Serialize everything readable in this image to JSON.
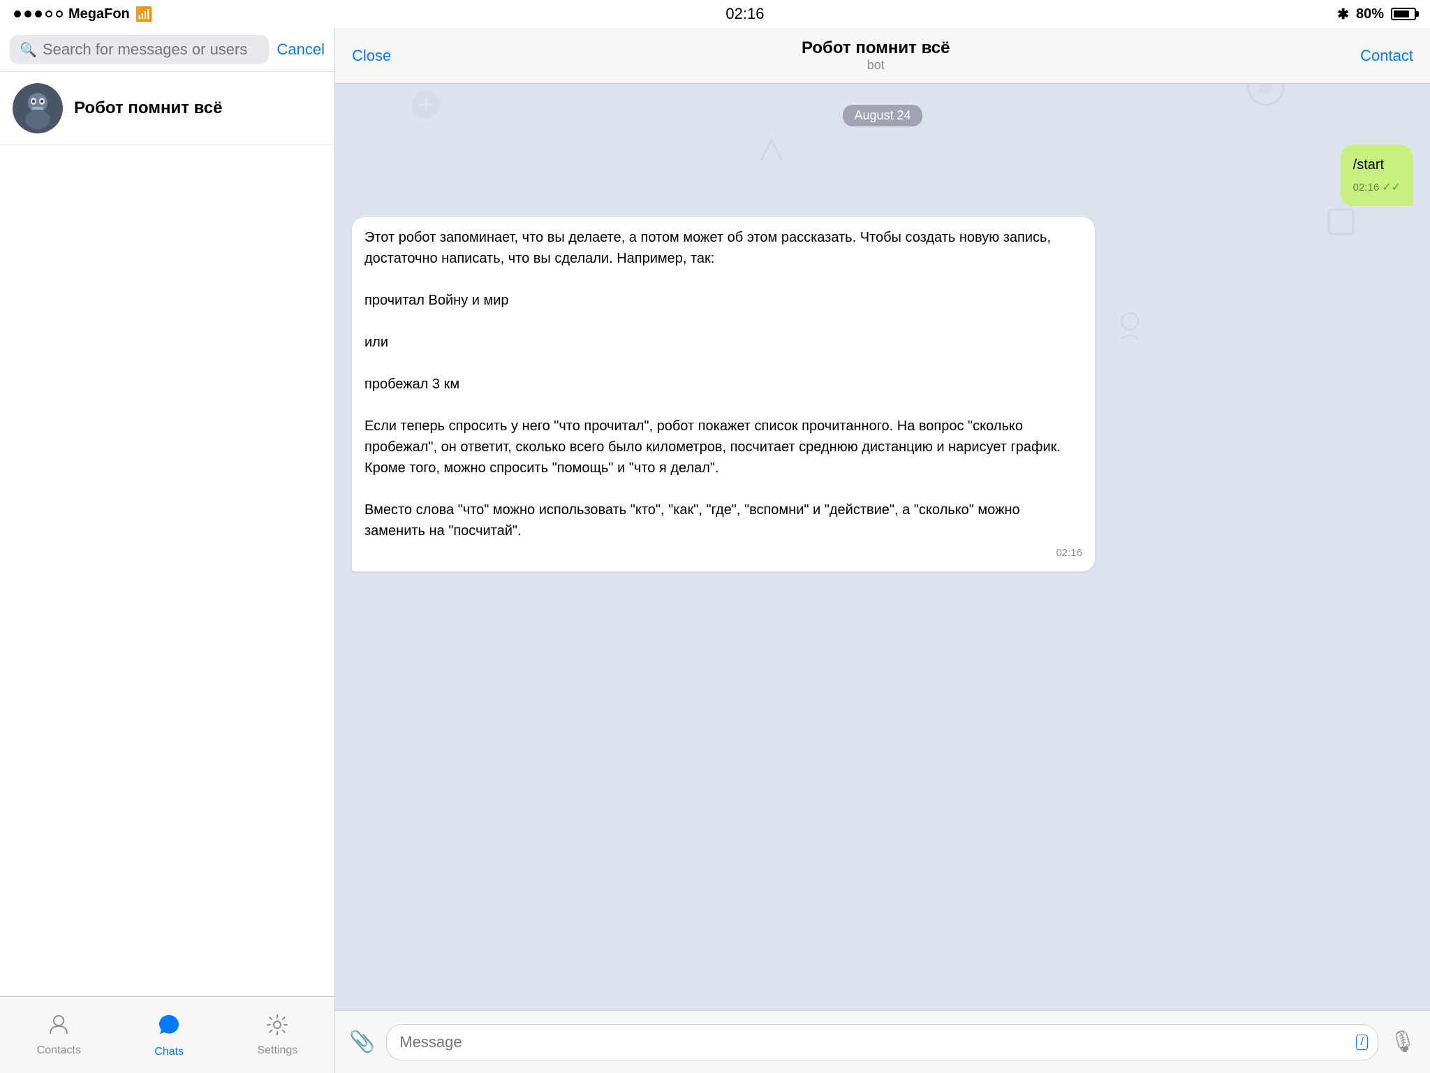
{
  "status_bar": {
    "carrier": "MegaFon",
    "time": "02:16",
    "battery_percent": "80%",
    "bluetooth": "⁎"
  },
  "search": {
    "placeholder": "Search for messages or users",
    "cancel_label": "Cancel"
  },
  "chat_list": {
    "items": [
      {
        "name": "Робот помнит всё",
        "id": "robot-chat"
      }
    ]
  },
  "bottom_nav": {
    "items": [
      {
        "label": "Contacts",
        "icon": "person",
        "active": false
      },
      {
        "label": "Chats",
        "icon": "chat",
        "active": true
      },
      {
        "label": "Settings",
        "icon": "gear",
        "active": false
      }
    ]
  },
  "chat_header": {
    "close_label": "Close",
    "title": "Робот помнит всё",
    "subtitle": "bot",
    "contact_label": "Contact"
  },
  "messages": {
    "date_separator": "August 24",
    "outgoing": {
      "text": "/start",
      "time": "02:16",
      "checkmarks": "✓✓"
    },
    "incoming": {
      "text": "Этот робот запоминает, что вы делаете, а потом может об этом рассказать. Чтобы создать новую запись, достаточно написать, что вы сделали. Например, так:\n\nпрочитал Войну и мир\n\nили\n\nпробежал 3 км\n\nЕсли теперь спросить у него \"что прочитал\", робот покажет список прочитанного. На вопрос \"сколько пробежал\", он ответит, сколько всего было километров, посчитает среднюю дистанцию и нарисует график. Кроме того, можно спросить \"помощь\" и \"что я делал\".\n\nВместо слова \"что\" можно использовать \"кто\", \"как\", \"где\", \"вспомни\" и \"действие\", а \"сколько\" можно заменить на \"посчитай\".",
      "time": "02:16"
    }
  },
  "input_bar": {
    "placeholder": "Message",
    "shortcut_icon": "/"
  }
}
